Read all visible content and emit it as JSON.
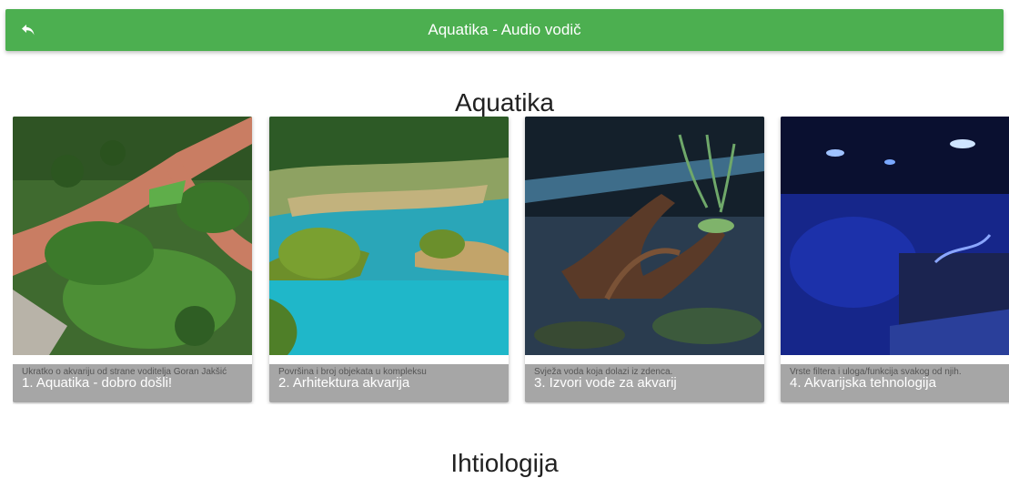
{
  "appbar": {
    "title": "Aquatika - Audio vodič",
    "back_icon": "back-arrow-icon",
    "color": "#4caf50"
  },
  "sections": [
    {
      "title": "Aquatika",
      "cards": [
        {
          "caption": "1. Aquatika - dobro došli!",
          "description": "Ukratko o akvariju od strane voditelja Goran Jakšić"
        },
        {
          "caption": "2. Arhitektura akvarija",
          "description": "Površina i broj objekata u kompleksu"
        },
        {
          "caption": "3. Izvori vode za akvarij",
          "description": "Svježa voda koja dolazi iz zdenca."
        },
        {
          "caption": "4. Akvarijska tehnologija",
          "description": "Vrste filtera i uloga/funkcija svakog od njih."
        }
      ]
    },
    {
      "title": "Ihtiologija"
    }
  ]
}
